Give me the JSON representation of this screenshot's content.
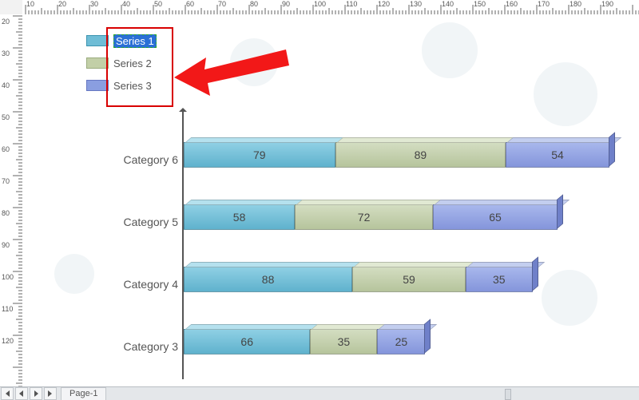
{
  "legend": {
    "items": [
      {
        "label": "Series 1",
        "color": "#6fbdd6",
        "editing": true
      },
      {
        "label": "Series 2",
        "color": "#c2cfa7",
        "editing": false
      },
      {
        "label": "Series 3",
        "color": "#8a9ee0",
        "editing": false
      }
    ]
  },
  "ruler": {
    "h_labels": [
      "10",
      "20",
      "30",
      "40",
      "50",
      "60",
      "70",
      "80",
      "90",
      "100",
      "110",
      "120",
      "130",
      "140",
      "150",
      "160",
      "170",
      "180",
      "190"
    ],
    "v_labels": [
      "20",
      "30",
      "40",
      "50",
      "60",
      "70",
      "80",
      "90",
      "100",
      "110",
      "120"
    ]
  },
  "tabbar": {
    "page_label": "Page-1"
  },
  "chart_data": {
    "type": "bar",
    "orientation": "horizontal",
    "stacked": true,
    "categories": [
      "Category 6",
      "Category 5",
      "Category 4",
      "Category 3"
    ],
    "series": [
      {
        "name": "Series 1",
        "color": "#6fbdd6",
        "values": [
          79,
          58,
          88,
          66
        ]
      },
      {
        "name": "Series 2",
        "color": "#c2cfa7",
        "values": [
          89,
          72,
          59,
          35
        ]
      },
      {
        "name": "Series 3",
        "color": "#8a9ee0",
        "values": [
          54,
          65,
          35,
          25
        ]
      }
    ],
    "xlabel": "",
    "ylabel": "",
    "title": "",
    "xlim": [
      0,
      240
    ]
  },
  "annotation": {
    "kind": "arrow",
    "color": "#f00"
  }
}
